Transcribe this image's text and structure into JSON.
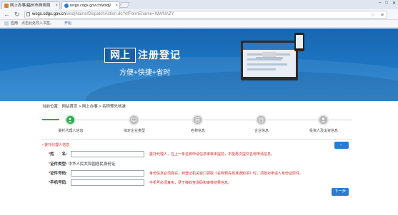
{
  "browser": {
    "tabs": [
      {
        "title": "网上办事|福州市商务局",
        "active": false
      },
      {
        "title": "wsgs.cdgs.gov.cn/wsdj/",
        "active": true
      }
    ],
    "window_controls": [
      "–",
      "□",
      "✕"
    ],
    "url_host": "wsgs.cdgs.gov.cn",
    "url_path": "/wsdjName/DispatchAction.do?efFormEname=WWNAZY",
    "bookmarks": {
      "apps_label": "应用",
      "import_hint": "点击此处导入书签。",
      "import_link": "开始"
    }
  },
  "banner": {
    "highlight": "网上",
    "title": "注册登记",
    "slogan": "方便+快捷+省时"
  },
  "breadcrumb": "当前位置：网站首页 > 网上办事 > 名称预先核准",
  "steps": [
    {
      "label": "委托代理人信息",
      "active": true,
      "icon": "user-edit-icon"
    },
    {
      "label": "拟定企业类型",
      "active": false,
      "icon": "monitor-icon"
    },
    {
      "label": "名称信息",
      "active": false,
      "icon": "document-icon"
    },
    {
      "label": "企业信息",
      "active": false,
      "icon": "building-icon"
    },
    {
      "label": "投资人及出资信息",
      "active": false,
      "icon": "person-icon"
    }
  ],
  "form": {
    "section_title": "委托代理人信息",
    "fields": [
      {
        "label": "姓　　名:",
        "value": "",
        "hint": "委托代理人，在上一条名称申请信息审核未提前，不能再次提交名称申请信息。"
      },
      {
        "label": "证件号码:",
        "value": "",
        "hint": "身份信息必须真实，到登记机关窗口领取《名称预先核准通知书》时，须核对申请人身份证原件。"
      },
      {
        "label": "手机号码:",
        "value": "",
        "hint": "手机号必须真实，便于接收查询码和审核结果信息。"
      }
    ],
    "id_type_label": "证件类型:",
    "id_type_value": "中华人民共和国居民身份证",
    "required_mark": "*",
    "next_button": "下一步"
  },
  "colors": {
    "banner_blue": "#1d77c4",
    "step_active": "#2fa84f",
    "required_red": "#d42a2a",
    "button_blue": "#2b7bd1"
  }
}
